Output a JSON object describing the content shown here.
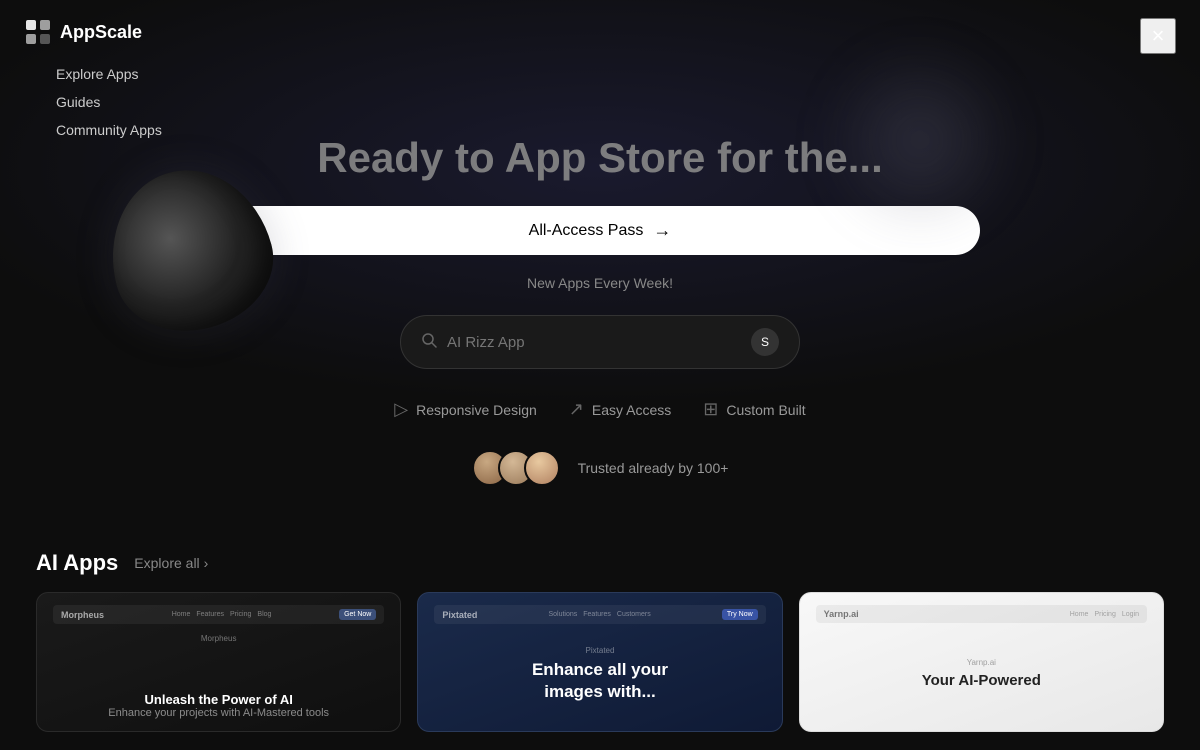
{
  "app": {
    "name": "AppScale",
    "logo_text": "AppScale"
  },
  "nav": {
    "explore_label": "Explore Apps",
    "guides_label": "Guides",
    "community_label": "Community Apps",
    "close_label": "×"
  },
  "hero": {
    "headline": "Ready to App Store for the...",
    "access_pass_label": "All-Access Pass",
    "access_pass_arrow": "→",
    "new_apps_text": "New Apps Every Week!",
    "search_placeholder": "AI Rizz App",
    "search_btn_label": "S",
    "trusted_text": "Trusted already by 100+",
    "features": [
      {
        "label": "Responsive Design",
        "icon": "▷"
      },
      {
        "label": "Easy Access",
        "icon": "↗"
      },
      {
        "label": "Custom Built",
        "icon": "⊞"
      }
    ]
  },
  "ai_apps": {
    "section_title": "AI Apps",
    "explore_all_label": "Explore all",
    "cards": [
      {
        "title": "Unleash the Power of AI",
        "subtitle": "Enhance your projects with AI-Mastered tools",
        "nav_logo": "Morpheus",
        "theme": "dark"
      },
      {
        "title": "Enhance all your images with...",
        "subtitle": "",
        "nav_logo": "Pixtated",
        "theme": "blue-dark"
      },
      {
        "title": "Your AI-Powered",
        "subtitle": "",
        "nav_logo": "Yarnp.ai",
        "theme": "light"
      }
    ]
  }
}
